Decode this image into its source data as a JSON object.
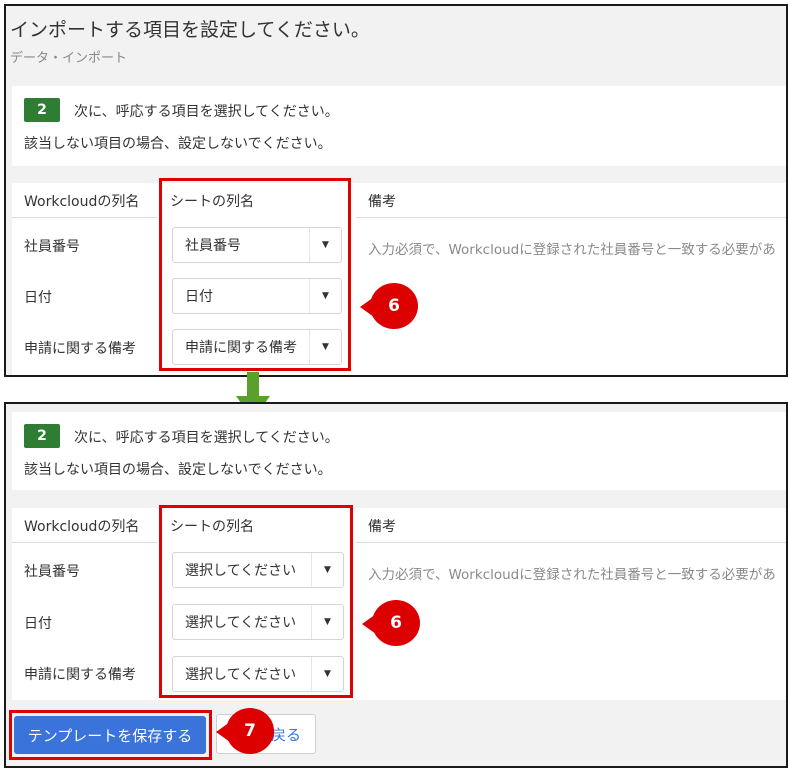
{
  "header": {
    "title": "インポートする項目を設定してください。",
    "breadcrumb": "データ・インポート"
  },
  "step": {
    "number": "2",
    "instruction": "次に、呼応する項目を選択してください。",
    "note": "該当しない項目の場合、設定しないでください。"
  },
  "table": {
    "col_workcloud": "Workcloudの列名",
    "col_sheet": "シートの列名",
    "col_remarks": "備考",
    "rows": [
      {
        "label": "社員番号",
        "remark": "入力必須で、Workcloudに登録された社員番号と一致する必要があ"
      },
      {
        "label": "日付",
        "remark": ""
      },
      {
        "label": "申請に関する備考",
        "remark": ""
      }
    ]
  },
  "before": {
    "selects": [
      "社員番号",
      "日付",
      "申請に関する備考"
    ]
  },
  "after": {
    "selects": [
      "選択してください",
      "選択してください",
      "選択してください"
    ]
  },
  "markers": {
    "six_top": "6",
    "six_bottom": "6",
    "seven": "7"
  },
  "footer": {
    "save_label": "テンプレートを保存する",
    "back_label": "戻る"
  },
  "colors": {
    "highlight": "#e00000",
    "marker": "#dd0000",
    "step_badge": "#2e7d32",
    "primary_button": "#3a73d9",
    "arrow": "#5aa02c"
  },
  "icons": {
    "caret": "caret-down-icon",
    "arrow": "arrow-down-icon"
  }
}
